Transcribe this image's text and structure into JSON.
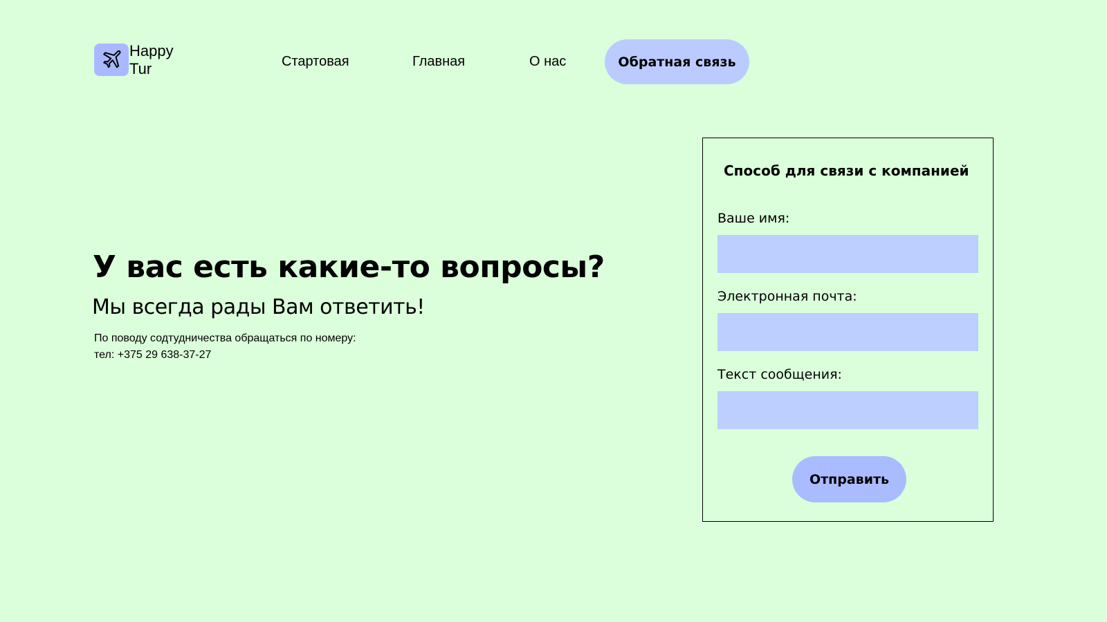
{
  "header": {
    "logo_icon": "airplane-icon",
    "logo_line1": "Happy",
    "logo_line2": "Tur",
    "nav": {
      "start": "Стартовая",
      "main": "Главная",
      "about": "О нас",
      "feedback": "Обратная связь"
    }
  },
  "hero": {
    "title": "У вас есть какие-то вопросы?",
    "subtitle": "Мы всегда рады Вам ответить!",
    "contact_line1": "По поводу содтудничества обращаться по номеру:",
    "contact_line2": "тел: +375 29 638-37-27"
  },
  "form": {
    "title": "Способ для связи с компанией",
    "name_label": "Ваше имя:",
    "email_label": "Электронная почта:",
    "message_label": "Текст сообщения:",
    "submit_label": "Отправить"
  },
  "colors": {
    "background": "#dbffdb",
    "accent": "#bccbff",
    "logo_bg": "#aab9ff"
  }
}
